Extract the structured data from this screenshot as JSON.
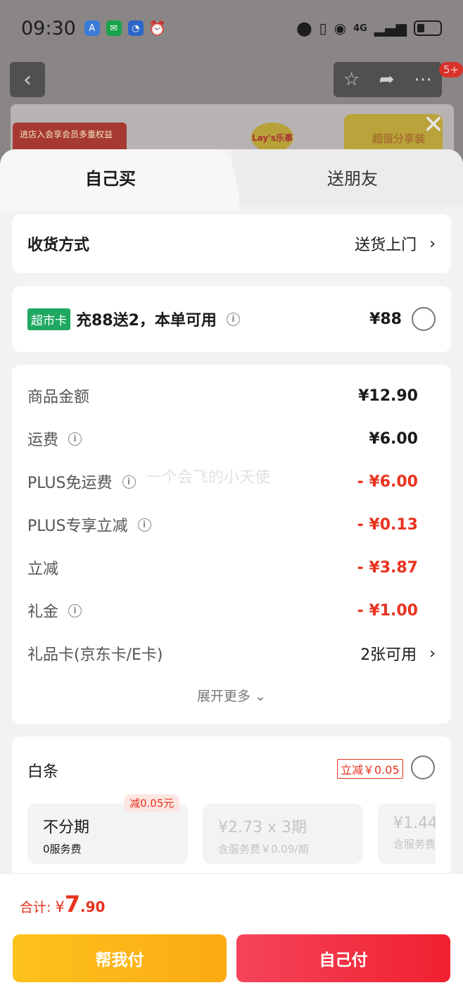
{
  "status_bar": {
    "time": "09:30",
    "network": "4G"
  },
  "tabs": {
    "self": "自己买",
    "friend": "送朋友"
  },
  "delivery": {
    "label": "收货方式",
    "value": "送货上门"
  },
  "super_card": {
    "tag": "超市卡",
    "text": "充88送2，本单可用",
    "price": "¥88"
  },
  "costs": [
    {
      "label": "商品金额",
      "value": "¥12.90",
      "info": false,
      "red": false
    },
    {
      "label": "运费",
      "value": "¥6.00",
      "info": true,
      "red": false
    },
    {
      "label": "PLUS免运费",
      "value": "- ¥6.00",
      "info": true,
      "red": true
    },
    {
      "label": "PLUS专享立减",
      "value": "- ¥0.13",
      "info": true,
      "red": true
    },
    {
      "label": "立减",
      "value": "- ¥3.87",
      "info": false,
      "red": true
    },
    {
      "label": "礼金",
      "value": "- ¥1.00",
      "info": true,
      "red": true
    }
  ],
  "gift_card": {
    "label": "礼品卡(京东卡/E卡)",
    "value": "2张可用"
  },
  "expand_more": "展开更多",
  "watermark": "一个会飞的小天使",
  "baitiao": {
    "title": "白条",
    "promo": "立减￥0.05",
    "plans": [
      {
        "main": "不分期",
        "sub": "0服务费",
        "badge": "减0.05元",
        "disabled": false
      },
      {
        "main": "¥2.73 x 3期",
        "sub": "含服务费￥0.09/期",
        "disabled": true
      },
      {
        "main": "¥1.44",
        "sub": "含服务费",
        "disabled": true
      }
    ]
  },
  "total": {
    "label": "合计:",
    "currency": "¥",
    "integer": "7",
    "decimal": ".90"
  },
  "buttons": {
    "help_pay": "帮我付",
    "self_pay": "自己付"
  },
  "background": {
    "nav_badge": "5+",
    "banner_text": "进店入会享会员多重权益",
    "brand_logo": "Lay's乐事",
    "bag_text": "超值分享装"
  },
  "colors": {
    "accent_red": "#e8321e",
    "super_card_green": "#1fa862",
    "help_pay_yellow": "#fdc21c",
    "self_pay_red": "#f0202f"
  },
  "icons": {
    "back": "chevron-left-icon",
    "favorite": "star-icon",
    "share": "share-icon",
    "more": "more-icon",
    "close": "close-icon",
    "info": "info-icon",
    "arrow": "chevron-right-icon"
  }
}
